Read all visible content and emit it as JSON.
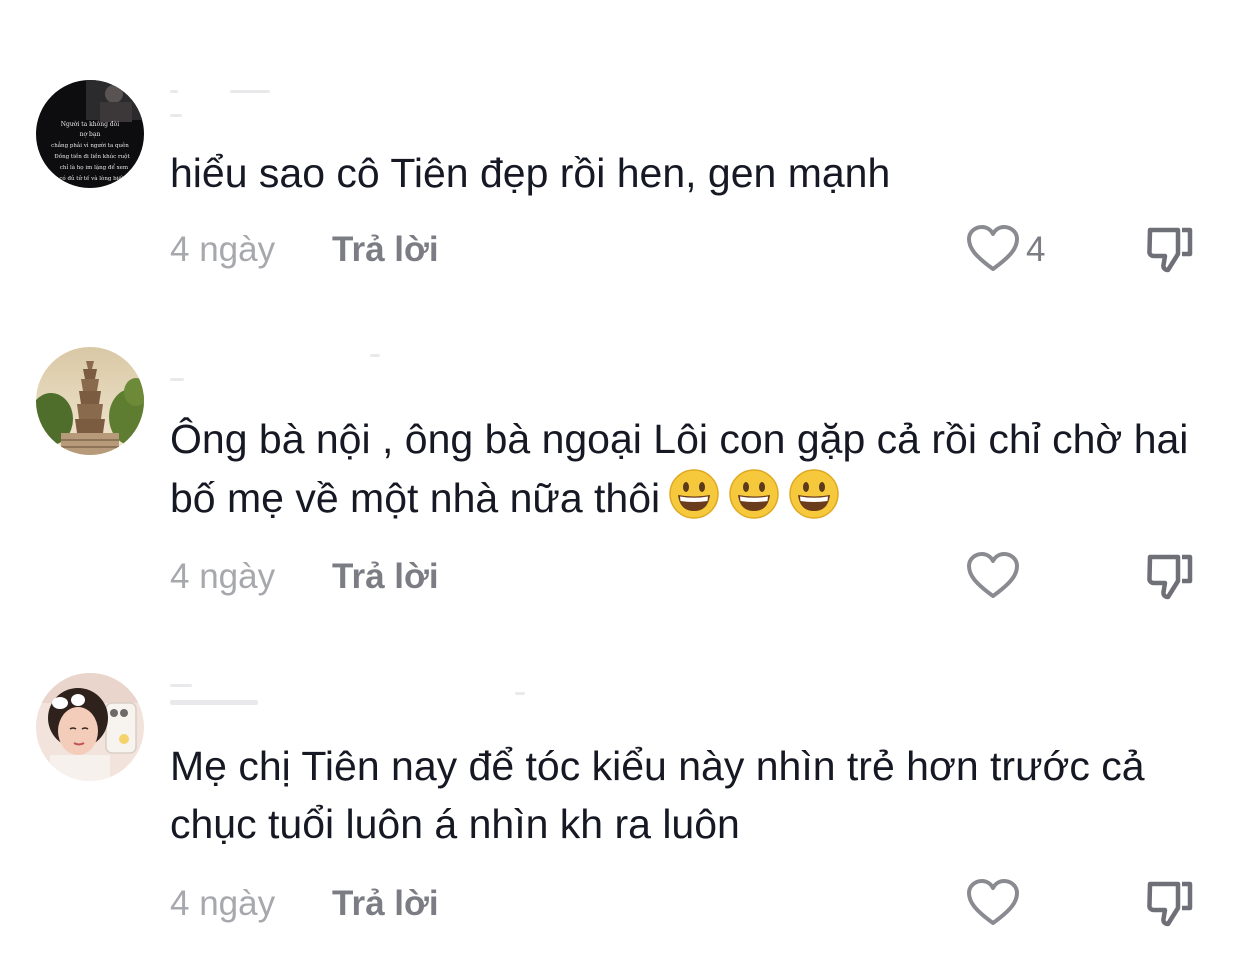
{
  "comments": [
    {
      "avatar": "avatar-quote-image-icon",
      "avatar_text": [
        "Người ta không đòi",
        "nợ bạn",
        "chẳng phải vì người ta quên",
        "Đồng tiền đi liền khúc ruột",
        "chỉ là họ im lặng để xem",
        "có đủ tử tế và lòng biết ơn"
      ],
      "text": "hiểu sao cô Tiên đẹp rồi hen, gen mạnh",
      "time": "4 ngày",
      "reply_label": "Trả lời",
      "like_count": "4"
    },
    {
      "avatar": "avatar-pagoda-icon",
      "text": "Ông bà nội , ông bà ngoại Lôi con gặp cả rồi chỉ chờ hai bố mẹ về một nhà nữa thôi",
      "emojis": [
        "grinning-face-icon",
        "grinning-face-icon",
        "grinning-face-icon"
      ],
      "time": "4 ngày",
      "reply_label": "Trả lời",
      "like_count": ""
    },
    {
      "avatar": "avatar-selfie-icon",
      "text": "Mẹ chị Tiên nay để tóc kiểu này nhìn trẻ hơn trước cả chục tuổi luôn á nhìn kh ra luôn",
      "time": "4 ngày",
      "reply_label": "Trả lời",
      "like_count": ""
    }
  ],
  "colors": {
    "text": "#161823",
    "muted": "#a7a8ad",
    "action": "#7c7d84",
    "emoji_face": "#f6c93c"
  }
}
